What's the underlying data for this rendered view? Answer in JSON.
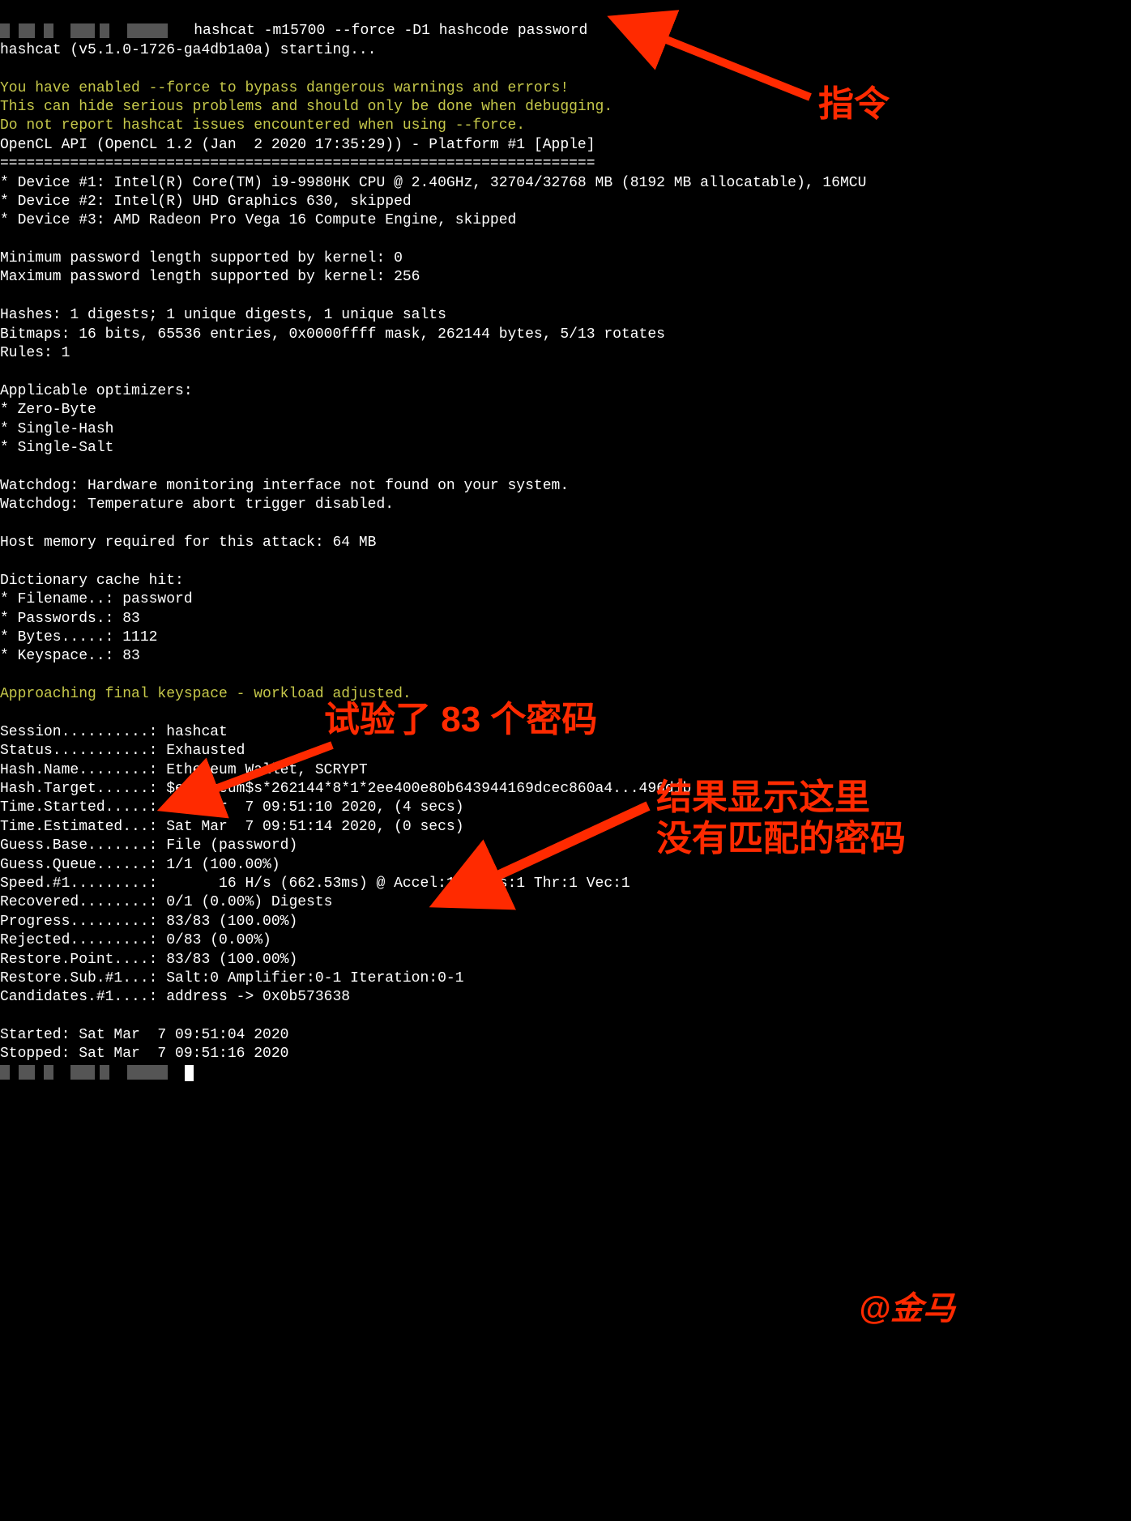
{
  "command_line": " hashcat -m15700 --force -D1 hashcode password",
  "starting_line": "hashcat (v5.1.0-1726-ga4db1a0a) starting...",
  "warn1": "You have enabled --force to bypass dangerous warnings and errors!",
  "warn2": "This can hide serious problems and should only be done when debugging.",
  "warn3": "Do not report hashcat issues encountered when using --force.",
  "opencl": "OpenCL API (OpenCL 1.2 (Jan  2 2020 17:35:29)) - Platform #1 [Apple]",
  "sep": "====================================================================",
  "dev1": "* Device #1: Intel(R) Core(TM) i9-9980HK CPU @ 2.40GHz, 32704/32768 MB (8192 MB allocatable), 16MCU",
  "dev2": "* Device #2: Intel(R) UHD Graphics 630, skipped",
  "dev3": "* Device #3: AMD Radeon Pro Vega 16 Compute Engine, skipped",
  "minpw": "Minimum password length supported by kernel: 0",
  "maxpw": "Maximum password length supported by kernel: 256",
  "hashes": "Hashes: 1 digests; 1 unique digests, 1 unique salts",
  "bitmaps": "Bitmaps: 16 bits, 65536 entries, 0x0000ffff mask, 262144 bytes, 5/13 rotates",
  "rules": "Rules: 1",
  "optim_hdr": "Applicable optimizers:",
  "opt1": "* Zero-Byte",
  "opt2": "* Single-Hash",
  "opt3": "* Single-Salt",
  "wd1": "Watchdog: Hardware monitoring interface not found on your system.",
  "wd2": "Watchdog: Temperature abort trigger disabled.",
  "hostmem": "Host memory required for this attack: 64 MB",
  "dict_hdr": "Dictionary cache hit:",
  "dict_fn": "* Filename..: password",
  "dict_pw": "* Passwords.: 83",
  "dict_by": "* Bytes.....: 1112",
  "dict_ks": "* Keyspace..: 83",
  "approaching": "Approaching final keyspace - workload adjusted.",
  "s_session": "Session..........: hashcat",
  "s_status": "Status...........: Exhausted",
  "s_hashname": "Hash.Name........: Ethereum Wallet, SCRYPT",
  "s_hashtgt": "Hash.Target......: $ethereum$s*262144*8*1*2ee400e80b643944169dcec860a4...496d1b",
  "s_tstart": "Time.Started.....: Sat Mar  7 09:51:10 2020, (4 secs)",
  "s_test": "Time.Estimated...: Sat Mar  7 09:51:14 2020, (0 secs)",
  "s_gbase": "Guess.Base.......: File (password)",
  "s_gqueue": "Guess.Queue......: 1/1 (100.00%)",
  "s_speed": "Speed.#1.........:       16 H/s (662.53ms) @ Accel:1 Loops:1 Thr:1 Vec:1",
  "s_recov": "Recovered........: 0/1 (0.00%) Digests",
  "s_prog": "Progress.........: 83/83 (100.00%)",
  "s_rej": "Rejected.........: 0/83 (0.00%)",
  "s_rpoint": "Restore.Point....: 83/83 (100.00%)",
  "s_rsub": "Restore.Sub.#1...: Salt:0 Amplifier:0-1 Iteration:0-1",
  "s_cand": "Candidates.#1....: address -> 0x0b573638",
  "started": "Started: Sat Mar  7 09:51:04 2020",
  "stopped": "Stopped: Sat Mar  7 09:51:16 2020",
  "annot_cmd": "指令",
  "annot_tried": "试验了 83 个密码",
  "annot_result_l1": "结果显示这里",
  "annot_result_l2": "没有匹配的密码",
  "annot_sig": "@金马"
}
